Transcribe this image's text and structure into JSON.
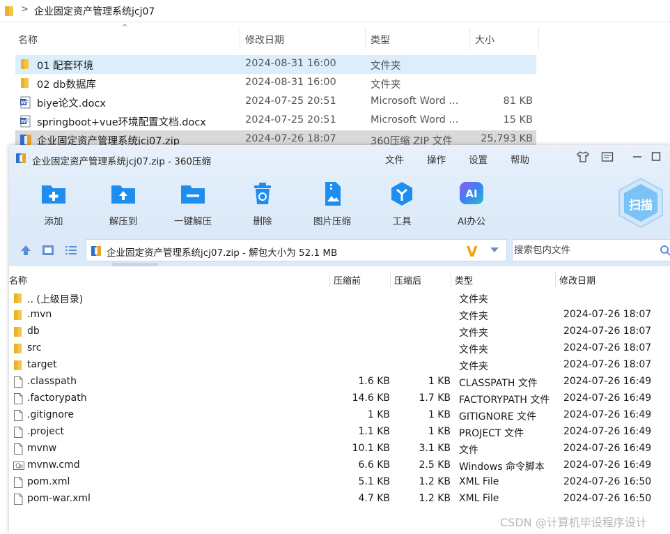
{
  "explorer": {
    "breadcrumb_sep": ">",
    "path": "企业固定资产管理系统jcj07",
    "sort_caret": "^",
    "columns": {
      "name": "名称",
      "date": "修改日期",
      "type": "类型",
      "size": "大小"
    },
    "rows": [
      {
        "name": "01 配套环境",
        "date": "2024-08-31 16:00",
        "type": "文件夹",
        "size": ""
      },
      {
        "name": "02 db数据库",
        "date": "2024-08-31 16:00",
        "type": "文件夹",
        "size": ""
      },
      {
        "name": "biye论文.docx",
        "date": "2024-07-25 20:51",
        "type": "Microsoft Word ...",
        "size": "81 KB"
      },
      {
        "name": "springboot+vue环境配置文档.docx",
        "date": "2024-07-25 20:51",
        "type": "Microsoft Word ...",
        "size": "15 KB"
      },
      {
        "name": "企业固定资产管理系统jcj07.zip",
        "date": "2024-07-26 18:07",
        "type": "360压缩 ZIP 文件",
        "size": "25,793 KB"
      }
    ]
  },
  "zip": {
    "title": "企业固定资产管理系统jcj07.zip - 360压缩",
    "menu": [
      "文件",
      "操作",
      "设置",
      "帮助"
    ],
    "toolbar": [
      {
        "label": "添加",
        "icon": "add-icon"
      },
      {
        "label": "解压到",
        "icon": "extract-to-icon"
      },
      {
        "label": "一键解压",
        "icon": "one-click-extract-icon"
      },
      {
        "label": "删除",
        "icon": "delete-icon"
      },
      {
        "label": "图片压缩",
        "icon": "image-compress-icon"
      },
      {
        "label": "工具",
        "icon": "tools-icon"
      },
      {
        "label": "AI办公",
        "icon": "ai-office-icon"
      }
    ],
    "scan_label": "扫描",
    "ai_badge": "AI",
    "path_text": "企业固定资产管理系统jcj07.zip - 解包大小为 52.1 MB",
    "path_logo": "V",
    "search_placeholder": "搜索包内文件",
    "columns": {
      "name": "名称",
      "packed": "压缩前",
      "compressed": "压缩后",
      "type": "类型",
      "date": "修改日期"
    },
    "rows": [
      {
        "name": ".. (上级目录)",
        "packed": "",
        "compressed": "",
        "type": "文件夹",
        "date": "",
        "kind": "folder"
      },
      {
        "name": ".mvn",
        "packed": "",
        "compressed": "",
        "type": "文件夹",
        "date": "2024-07-26 18:07",
        "kind": "folder"
      },
      {
        "name": "db",
        "packed": "",
        "compressed": "",
        "type": "文件夹",
        "date": "2024-07-26 18:07",
        "kind": "folder"
      },
      {
        "name": "src",
        "packed": "",
        "compressed": "",
        "type": "文件夹",
        "date": "2024-07-26 18:07",
        "kind": "folder"
      },
      {
        "name": "target",
        "packed": "",
        "compressed": "",
        "type": "文件夹",
        "date": "2024-07-26 18:07",
        "kind": "folder"
      },
      {
        "name": ".classpath",
        "packed": "1.6 KB",
        "compressed": "1 KB",
        "type": "CLASSPATH 文件",
        "date": "2024-07-26 16:49",
        "kind": "file"
      },
      {
        "name": ".factorypath",
        "packed": "14.6 KB",
        "compressed": "1.7 KB",
        "type": "FACTORYPATH 文件",
        "date": "2024-07-26 16:49",
        "kind": "file"
      },
      {
        "name": ".gitignore",
        "packed": "1 KB",
        "compressed": "1 KB",
        "type": "GITIGNORE 文件",
        "date": "2024-07-26 16:49",
        "kind": "file"
      },
      {
        "name": ".project",
        "packed": "1.1 KB",
        "compressed": "1 KB",
        "type": "PROJECT 文件",
        "date": "2024-07-26 16:49",
        "kind": "file"
      },
      {
        "name": "mvnw",
        "packed": "10.1 KB",
        "compressed": "3.1 KB",
        "type": "文件",
        "date": "2024-07-26 16:49",
        "kind": "file"
      },
      {
        "name": "mvnw.cmd",
        "packed": "6.6 KB",
        "compressed": "2.5 KB",
        "type": "Windows 命令脚本",
        "date": "2024-07-26 16:49",
        "kind": "cmd"
      },
      {
        "name": "pom.xml",
        "packed": "5.1 KB",
        "compressed": "1.2 KB",
        "type": "XML File",
        "date": "2024-07-26 16:50",
        "kind": "file"
      },
      {
        "name": "pom-war.xml",
        "packed": "4.7 KB",
        "compressed": "1.2 KB",
        "type": "XML File",
        "date": "2024-07-26 16:50",
        "kind": "file"
      }
    ]
  },
  "watermark": "CSDN @计算机毕设程序设计",
  "colors": {
    "accent": "#1d8ef0",
    "folder": "#f5c542",
    "selection": "#dbeefc",
    "toolbar_bg": "#e3eefa"
  }
}
